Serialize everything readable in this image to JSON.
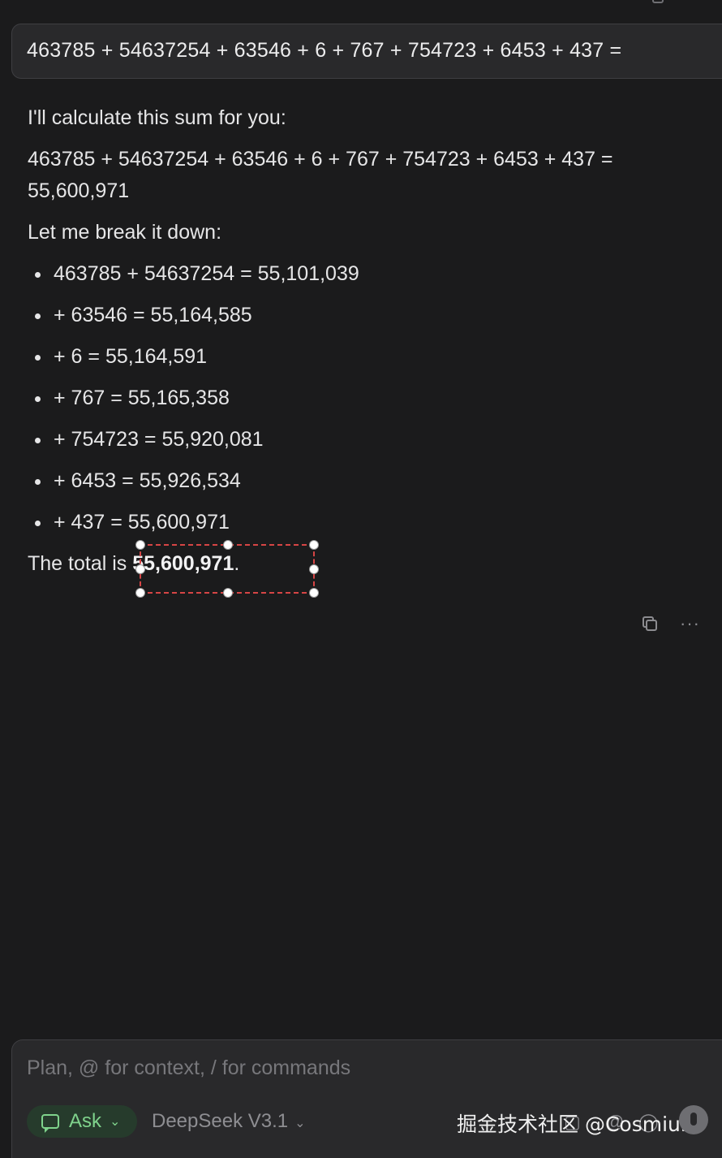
{
  "user_message": "463785 + 54637254 + 63546 + 6 + 767 + 754723 + 6453 + 437 =",
  "response": {
    "intro": "I'll calculate this sum for you:",
    "equation": "463785 + 54637254 + 63546 + 6 + 767 + 754723 + 6453 + 437 = 55,600,971",
    "breakdown_label": "Let me break it down:",
    "steps": [
      "463785 + 54637254 = 55,101,039",
      "+ 63546 = 55,164,585",
      "+ 6 = 55,164,591",
      "+ 767 = 55,165,358",
      "+ 754723 = 55,920,081",
      "+ 6453 = 55,926,534",
      "+ 437 = 55,600,971"
    ],
    "total_prefix": "The total is ",
    "total_value": "55,600,971",
    "total_suffix": "."
  },
  "composer": {
    "placeholder": "Plan, @ for context, / for commands",
    "mode_label": "Ask",
    "model_label": "DeepSeek V3.1",
    "watermark": "掘金技术社区 @Cosmium"
  },
  "icons": {
    "copy": "copy-icon",
    "more": "more-icon",
    "chat": "chat-icon",
    "send": "send-icon"
  },
  "colors": {
    "background": "#1b1b1c",
    "bubble": "#29292b",
    "accent_green": "#7fd38c",
    "selection_red": "#d64545"
  }
}
